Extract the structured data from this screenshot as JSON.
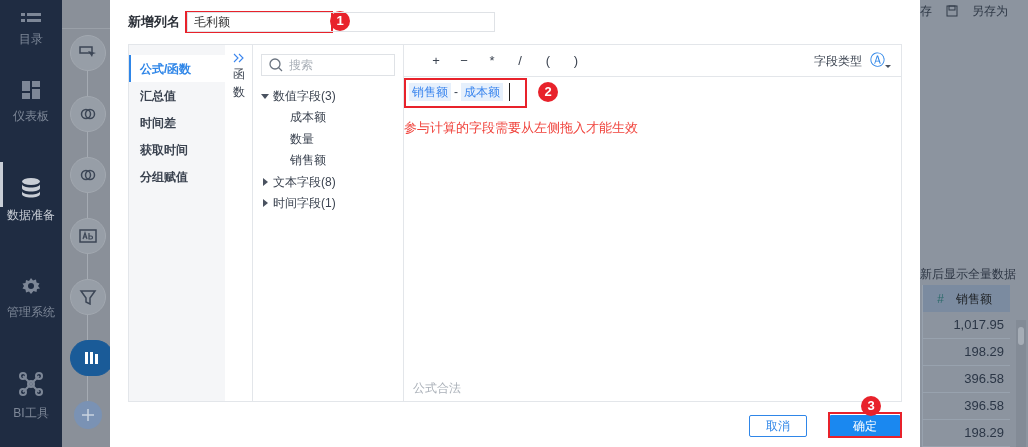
{
  "sidebar": {
    "items": [
      {
        "label": "目录",
        "selected": false
      },
      {
        "label": "仪表板",
        "selected": false
      },
      {
        "label": "数据准备",
        "selected": true
      },
      {
        "label": "管理系统",
        "selected": false
      },
      {
        "label": "BI工具",
        "selected": false
      }
    ]
  },
  "background": {
    "toolbar": [
      "存",
      "另存为"
    ],
    "notice": "新后显示全量数据",
    "steps": [
      {
        "selected": false
      },
      {
        "selected": false
      },
      {
        "selected": false
      },
      {
        "selected": false
      },
      {
        "selected": false
      },
      {
        "selected": true
      }
    ],
    "table": {
      "column": {
        "type_mark": "#",
        "label": "销售额"
      },
      "rows": [
        "1,017.95",
        "198.29",
        "396.58",
        "396.58",
        "198.29"
      ]
    }
  },
  "dialog": {
    "name_label": "新增列名",
    "name_value": "毛利额",
    "name_annotation": "1",
    "categories": [
      {
        "label": "公式/函数",
        "selected": true
      },
      {
        "label": "汇总值",
        "selected": false
      },
      {
        "label": "时间差",
        "selected": false
      },
      {
        "label": "获取时间",
        "selected": false
      },
      {
        "label": "分组赋值",
        "selected": false
      }
    ],
    "function_tab": "函数",
    "search": {
      "placeholder": "搜索"
    },
    "tree": [
      {
        "label": "数值字段(3)",
        "expanded": true,
        "children": [
          {
            "label": "成本额"
          },
          {
            "label": "数量"
          },
          {
            "label": "销售额"
          }
        ]
      },
      {
        "label": "文本字段(8)",
        "expanded": false
      },
      {
        "label": "时间字段(1)",
        "expanded": false
      }
    ],
    "operators": [
      "+",
      "−",
      "*",
      "/",
      "(",
      ")"
    ],
    "field_type_label": "字段类型",
    "field_type_glyph": "Ⓐ",
    "formula": [
      {
        "kind": "field",
        "text": "销售额"
      },
      {
        "kind": "operator",
        "text": "-"
      },
      {
        "kind": "field",
        "text": "成本额"
      }
    ],
    "formula_annotation": "2",
    "hint": "参与计算的字段需要从左侧拖入才能生效",
    "status": "公式合法",
    "buttons": [
      {
        "label": "取消",
        "kind": "secondary"
      },
      {
        "label": "确定",
        "kind": "primary",
        "annotation": "3"
      }
    ]
  }
}
